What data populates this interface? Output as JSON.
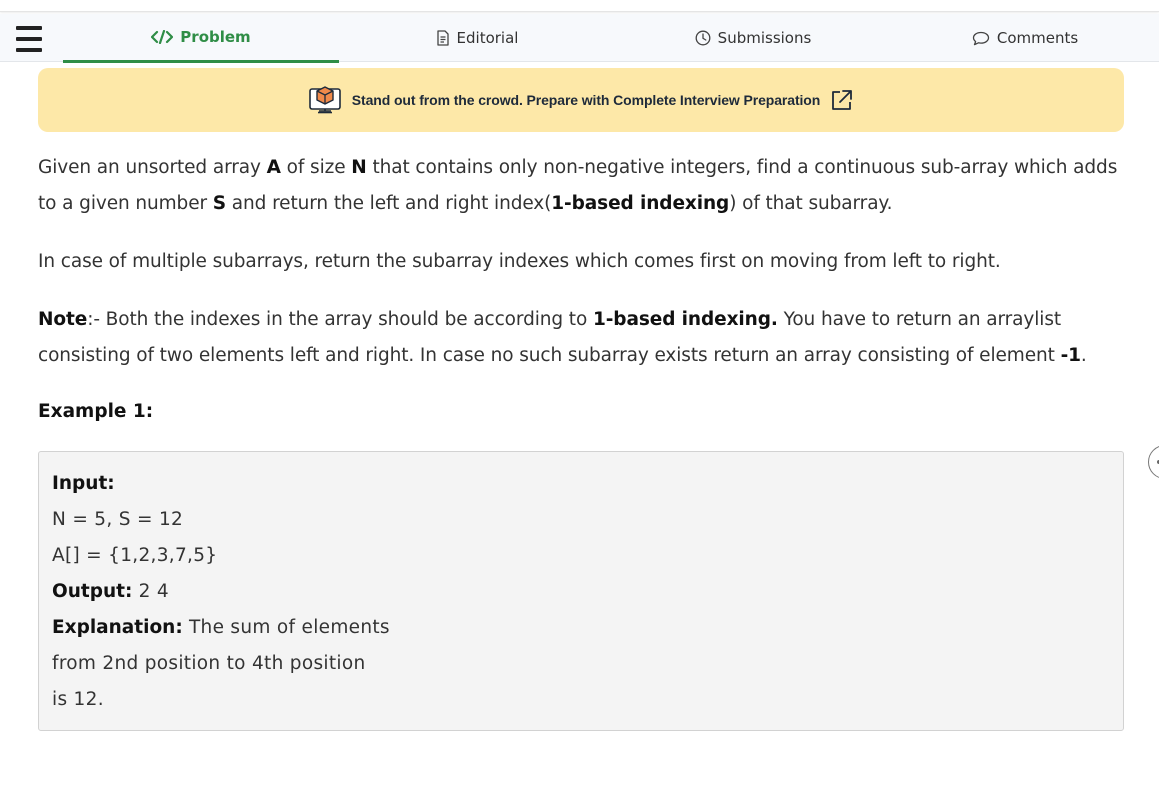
{
  "tabs": {
    "problem": "Problem",
    "editorial": "Editorial",
    "submissions": "Submissions",
    "comments": "Comments"
  },
  "banner": {
    "text": "Stand out from the crowd. Prepare with Complete Interview Preparation"
  },
  "problem": {
    "p1": {
      "t1": "Given an unsorted array ",
      "b1": "A",
      "t2": " of size ",
      "b2": "N",
      "t3": " that contains only non-negative integers, find a continuous sub-array which adds to a given number ",
      "b3": "S",
      "t4": " and return the left and right index(",
      "b4": "1-based indexing",
      "t5": ") of that subarray."
    },
    "p2": "In case of multiple subarrays, return the subarray indexes which comes first on moving from left to right.",
    "p3": {
      "b1": "Note",
      "t1": ":- Both the indexes in the array should be according to ",
      "b2": "1-based indexing.",
      "t2": " You have to return an arraylist consisting of two elements left and right. In case no such subarray exists return an array consisting of element ",
      "b3": "-1",
      "t3": "."
    },
    "example_title": "Example 1:"
  },
  "example": {
    "input_label": "Input:",
    "input_line1": "N = 5, S = 12",
    "input_line2": "A[] = {1,2,3,7,5}",
    "output_label": "Output:",
    "output_value": " 2 4",
    "explanation_label": "Explanation:",
    "explanation_line1": " The sum of elements",
    "explanation_line2": "from 2nd position to 4th position",
    "explanation_line3": "is 12."
  },
  "colors": {
    "accent": "#2f8d46",
    "banner_bg": "#fde8a8",
    "example_bg": "#f4f4f4"
  },
  "icons": [
    "menu-icon",
    "code-icon",
    "document-icon",
    "clock-icon",
    "comment-icon",
    "laptop-box-icon",
    "external-link-icon"
  ]
}
